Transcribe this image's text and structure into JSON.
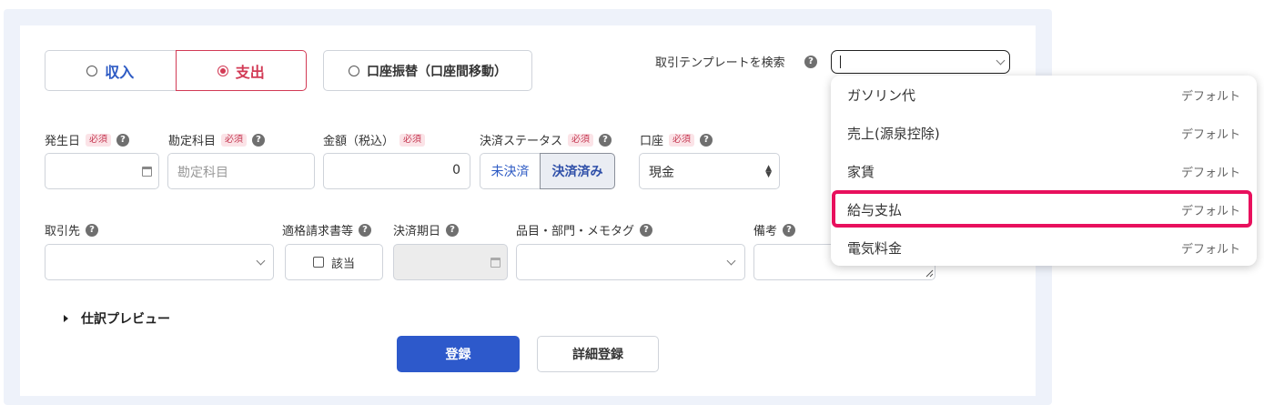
{
  "type_selector": {
    "income_label": "収入",
    "expense_label": "支出",
    "transfer_label": "口座振替（口座間移動）"
  },
  "template_search": {
    "label": "取引テンプレートを検索",
    "value": ""
  },
  "help_glyph": "?",
  "required_badge": "必須",
  "fields": {
    "date_label": "発生日",
    "account_item_label": "勘定科目",
    "account_item_placeholder": "勘定科目",
    "amount_label": "金額（税込）",
    "amount_value": "0",
    "status_label": "決済ステータス",
    "status_unsettled": "未決済",
    "status_settled": "決済済み",
    "wallet_label": "口座",
    "wallet_value": "現金",
    "partner_label": "取引先",
    "invoice_label": "適格請求書等",
    "invoice_checkbox_label": "該当",
    "due_date_label": "決済期日",
    "tags_label": "品目・部門・メモタグ",
    "note_label": "備考"
  },
  "journal_preview_label": "仕訳プレビュー",
  "buttons": {
    "register": "登録",
    "detailed_register": "詳細登録"
  },
  "dropdown": {
    "highlighted_index": 3,
    "items": [
      {
        "name": "ガソリン代",
        "tag": "デフォルト"
      },
      {
        "name": "売上(源泉控除)",
        "tag": "デフォルト"
      },
      {
        "name": "家賃",
        "tag": "デフォルト"
      },
      {
        "name": "給与支払",
        "tag": "デフォルト"
      },
      {
        "name": "電気料金",
        "tag": "デフォルト"
      }
    ]
  },
  "colors": {
    "accent_blue": "#2d59cb",
    "expense_red": "#d23a55",
    "highlight_pink": "#e8105d",
    "page_bg": "#eef2fa"
  }
}
